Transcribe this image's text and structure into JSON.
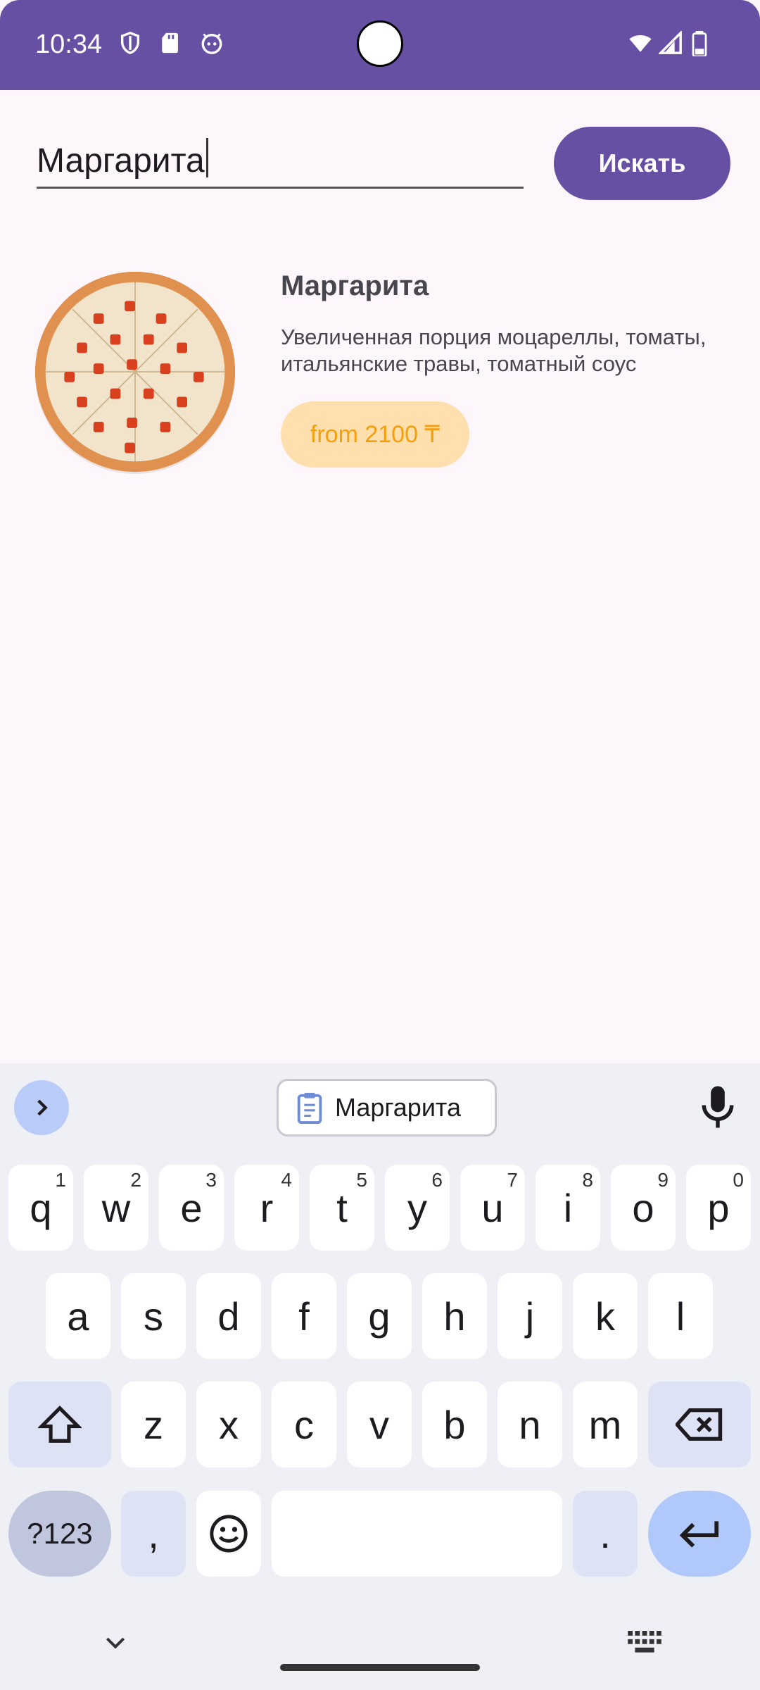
{
  "status_bar": {
    "time": "10:34",
    "left_icons": [
      "shield-icon",
      "sd-card-icon",
      "robot-face-icon"
    ],
    "right_icons": [
      "wifi-icon",
      "signal-icon",
      "battery-icon"
    ],
    "color": "#6750A4"
  },
  "search": {
    "value": "Маргарита",
    "button_label": "Искать"
  },
  "product": {
    "title": "Маргарита",
    "description": "Увеличенная порция моцареллы, томаты, итальянские травы, томатный соус",
    "price": "from 2100 ₸",
    "image": "pizza-image"
  },
  "keyboard": {
    "clipboard_suggestion": "Маргарита",
    "rows": [
      [
        {
          "k": "q",
          "h": "1"
        },
        {
          "k": "w",
          "h": "2"
        },
        {
          "k": "e",
          "h": "3"
        },
        {
          "k": "r",
          "h": "4"
        },
        {
          "k": "t",
          "h": "5"
        },
        {
          "k": "y",
          "h": "6"
        },
        {
          "k": "u",
          "h": "7"
        },
        {
          "k": "i",
          "h": "8"
        },
        {
          "k": "o",
          "h": "9"
        },
        {
          "k": "p",
          "h": "0"
        }
      ],
      [
        {
          "k": "a"
        },
        {
          "k": "s"
        },
        {
          "k": "d"
        },
        {
          "k": "f"
        },
        {
          "k": "g"
        },
        {
          "k": "h"
        },
        {
          "k": "j"
        },
        {
          "k": "k"
        },
        {
          "k": "l"
        }
      ],
      [
        {
          "k": "z"
        },
        {
          "k": "x"
        },
        {
          "k": "c"
        },
        {
          "k": "v"
        },
        {
          "k": "b"
        },
        {
          "k": "n"
        },
        {
          "k": "m"
        }
      ]
    ],
    "symbols_label": "?123",
    "comma": ",",
    "period": "."
  },
  "colors": {
    "accent": "#6750A4",
    "price_chip": "#FFDFAE",
    "price_text": "#F59F0C"
  }
}
